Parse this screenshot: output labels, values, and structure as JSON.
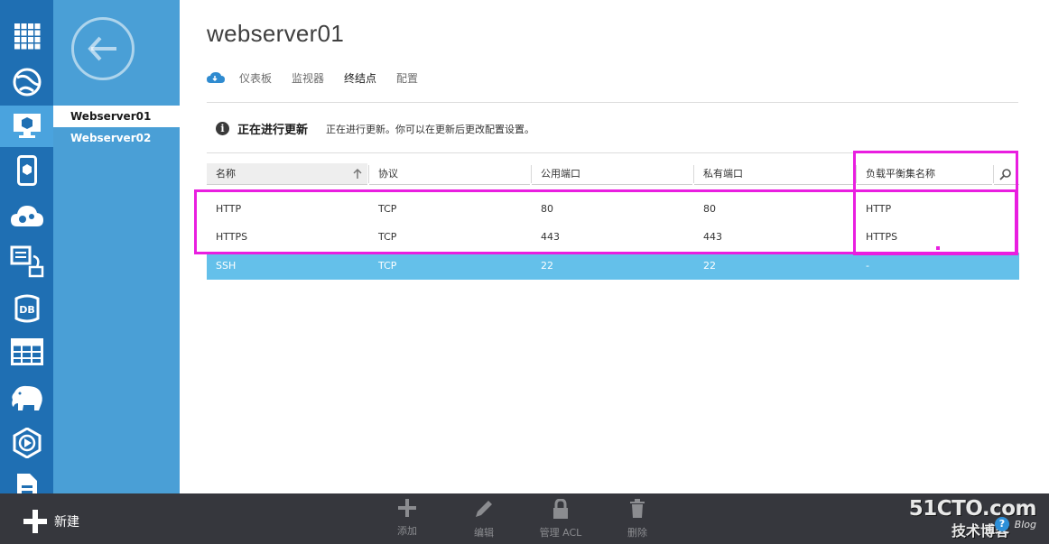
{
  "rail": {
    "items": [
      {
        "icon": "grid-icon"
      },
      {
        "icon": "globe-icon"
      },
      {
        "icon": "virtual-machine-icon",
        "active": true
      },
      {
        "icon": "mobile-service-icon"
      },
      {
        "icon": "cloud-services-icon"
      },
      {
        "icon": "batch-icon"
      },
      {
        "icon": "database-icon",
        "label": "DB"
      },
      {
        "icon": "table-storage-icon"
      },
      {
        "icon": "hdinsight-elephant-icon"
      },
      {
        "icon": "media-services-icon"
      },
      {
        "icon": "document-icon"
      }
    ]
  },
  "subnav": {
    "items": [
      {
        "label": "Webserver01",
        "selected": true
      },
      {
        "label": "Webserver02",
        "selected": false
      }
    ]
  },
  "header": {
    "title": "webserver01",
    "tabs": [
      {
        "label": "仪表板",
        "active": false
      },
      {
        "label": "监视器",
        "active": false
      },
      {
        "label": "终结点",
        "active": true
      },
      {
        "label": "配置",
        "active": false
      }
    ]
  },
  "notice": {
    "icon": "info-icon",
    "title": "正在进行更新",
    "text": "正在进行更新。你可以在更新后更改配置设置。"
  },
  "table": {
    "columns": [
      "名称",
      "协议",
      "公用端口",
      "私有端口",
      "负载平衡集名称"
    ],
    "rows": [
      {
        "name": "HTTP",
        "protocol": "TCP",
        "public_port": "80",
        "private_port": "80",
        "lb_set": "HTTP",
        "selected": false
      },
      {
        "name": "HTTPS",
        "protocol": "TCP",
        "public_port": "443",
        "private_port": "443",
        "lb_set": "HTTPS",
        "selected": false
      },
      {
        "name": "SSH",
        "protocol": "TCP",
        "public_port": "22",
        "private_port": "22",
        "lb_set": "-",
        "selected": true
      }
    ]
  },
  "commandbar": {
    "new_label": "新建",
    "commands": [
      {
        "icon": "plus-icon",
        "label": "添加"
      },
      {
        "icon": "pencil-icon",
        "label": "编辑"
      },
      {
        "icon": "lock-icon",
        "label": "管理 ACL"
      },
      {
        "icon": "trash-icon",
        "label": "删除"
      }
    ]
  },
  "watermark": {
    "site": "51CTO.com",
    "subtitle": "技术博客",
    "blog": "Blog"
  },
  "colors": {
    "rail": "#1f6fb3",
    "subnav": "#4a9fd6",
    "selected_row": "#64c0ea",
    "highlight": "#e91ee0",
    "command_bar": "#36373d"
  }
}
